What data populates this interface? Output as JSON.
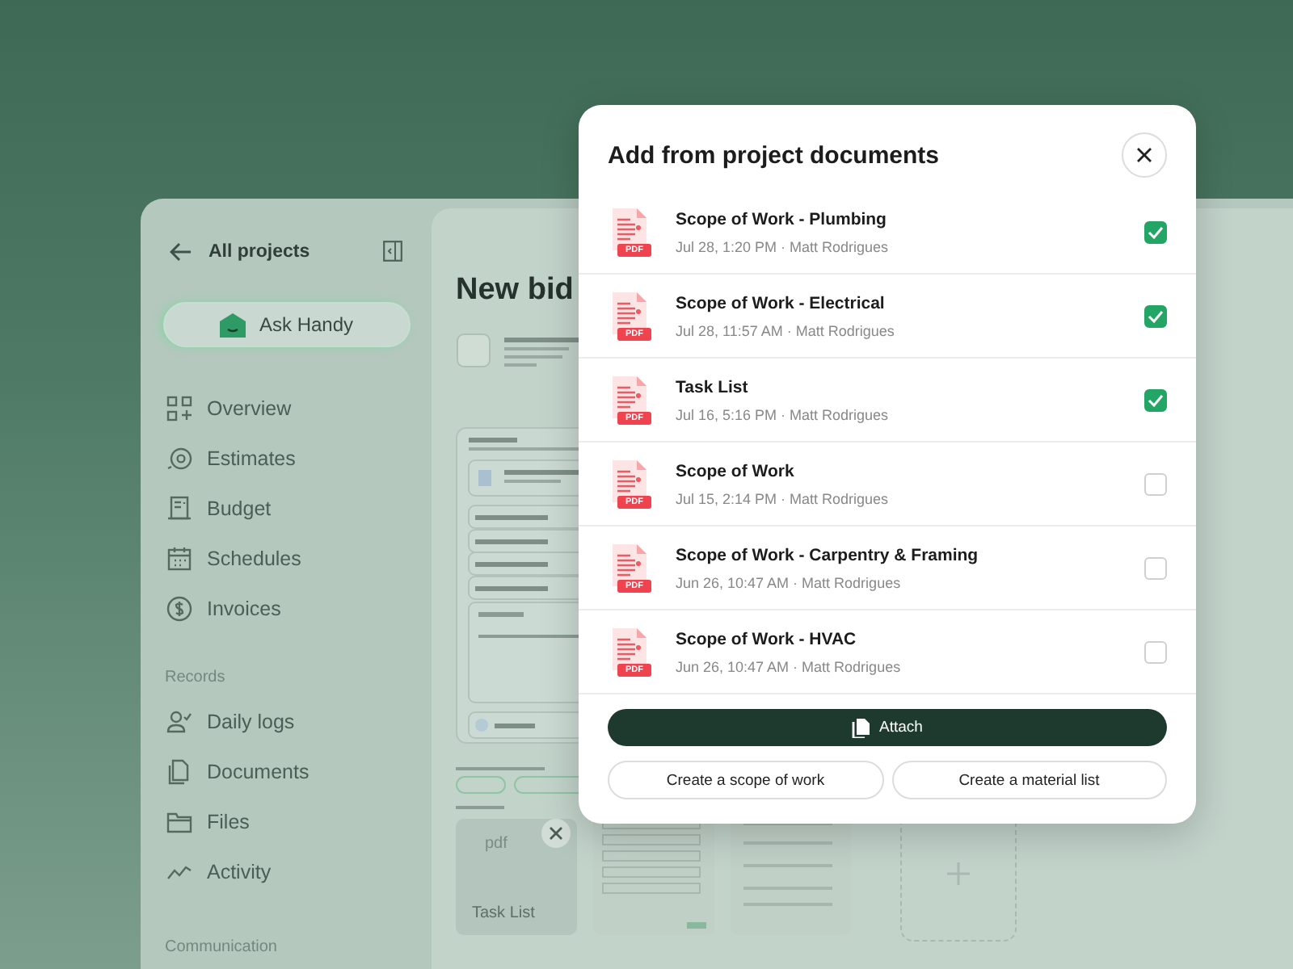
{
  "sidebar": {
    "back_label": "All projects",
    "assistant_button": "Ask Handy",
    "groups": [
      {
        "items": [
          {
            "label": "Overview"
          },
          {
            "label": "Estimates"
          },
          {
            "label": "Budget"
          },
          {
            "label": "Schedules"
          },
          {
            "label": "Invoices"
          }
        ]
      },
      {
        "title": "Records",
        "items": [
          {
            "label": "Daily logs"
          },
          {
            "label": "Documents"
          },
          {
            "label": "Files"
          },
          {
            "label": "Activity"
          }
        ]
      }
    ],
    "footer_label": "Communication"
  },
  "main": {
    "title": "New bid",
    "attachment": {
      "type_label": "pdf",
      "name": "Task List"
    }
  },
  "modal": {
    "title": "Add from project documents",
    "documents": [
      {
        "badge": "PDF",
        "name": "Scope of Work - Plumbing",
        "meta": "Jul 28, 1:20 PM · Matt Rodrigues",
        "checked": true
      },
      {
        "badge": "PDF",
        "name": "Scope of Work - Electrical",
        "meta": "Jul 28, 11:57 AM · Matt Rodrigues",
        "checked": true
      },
      {
        "badge": "PDF",
        "name": "Task List",
        "meta": "Jul 16, 5:16 PM · Matt Rodrigues",
        "checked": true
      },
      {
        "badge": "PDF",
        "name": "Scope of Work",
        "meta": "Jul 15, 2:14 PM · Matt Rodrigues",
        "checked": false
      },
      {
        "badge": "PDF",
        "name": "Scope of Work - Carpentry & Framing",
        "meta": "Jun 26, 10:47 AM · Matt Rodrigues",
        "checked": false
      },
      {
        "badge": "PDF",
        "name": "Scope of Work - HVAC",
        "meta": "Jun 26, 10:47 AM · Matt Rodrigues",
        "checked": false
      }
    ],
    "attach_button": "Attach",
    "secondary_buttons": [
      "Create a scope of work",
      "Create a material list"
    ]
  }
}
